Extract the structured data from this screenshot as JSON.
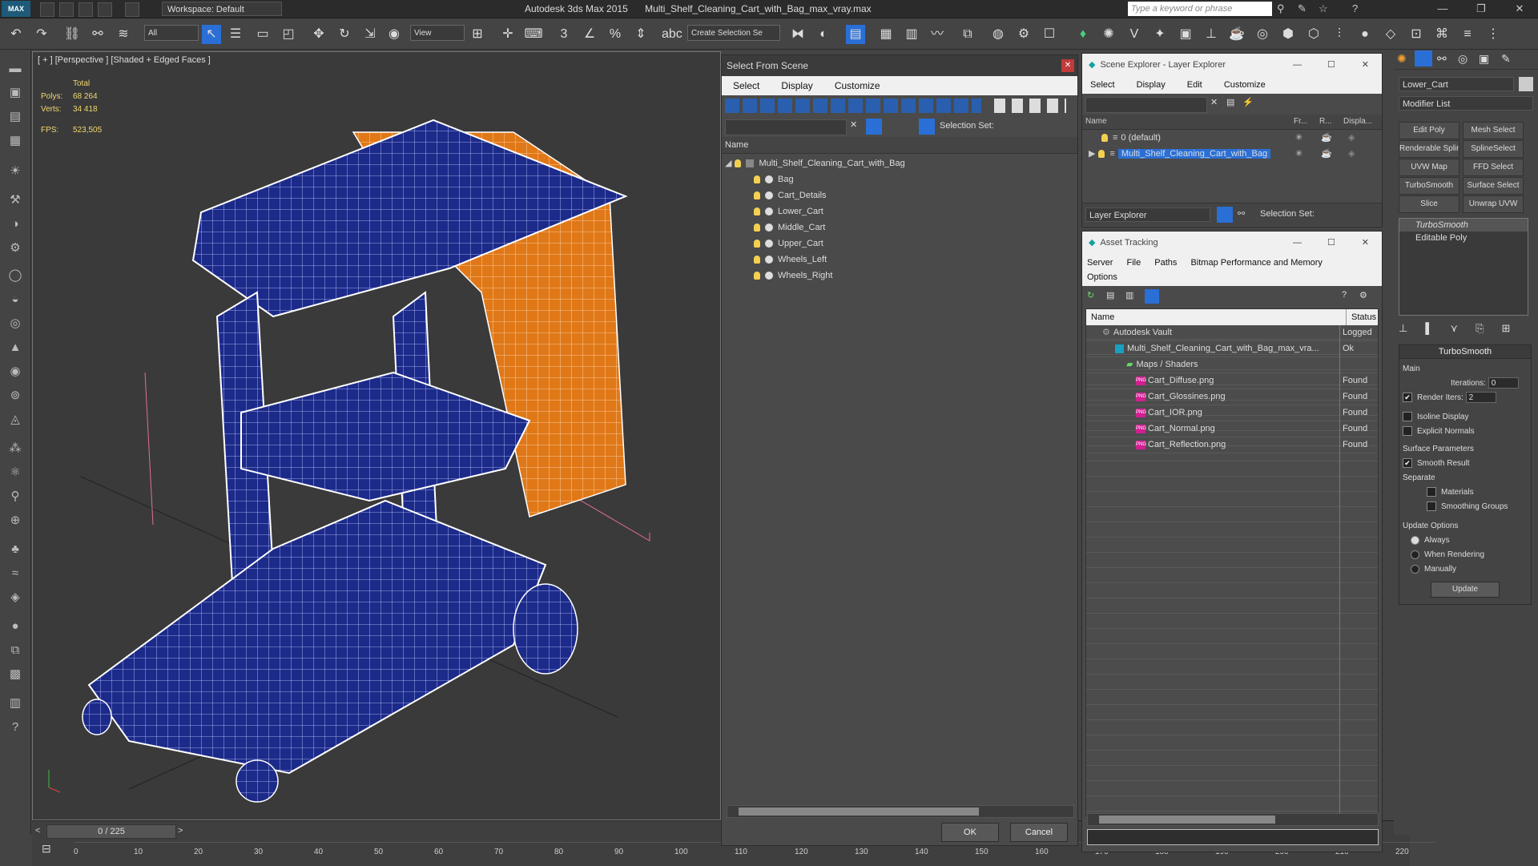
{
  "titlebar": {
    "logo": "MAX",
    "workspace": "Workspace: Default",
    "app_name": "Autodesk 3ds Max  2015",
    "file_name": "Multi_Shelf_Cleaning_Cart_with_Bag_max_vray.max",
    "search_placeholder": "Type a keyword or phrase"
  },
  "toolbar": {
    "selection_filter": "All",
    "ref_coord": "View",
    "create_selection_set": "Create Selection Se"
  },
  "viewport": {
    "label": "[ + ] [Perspective ] [Shaded + Edged Faces ]",
    "stats": {
      "total_label": "Total",
      "polys_label": "Polys:",
      "polys_value": "68 264",
      "verts_label": "Verts:",
      "verts_value": "34 418",
      "fps_label": "FPS:",
      "fps_value": "523,505"
    }
  },
  "timeline": {
    "frame_counter": "0 / 225",
    "ticks": [
      "0",
      "10",
      "20",
      "30",
      "40",
      "50",
      "60",
      "70",
      "80",
      "90",
      "100",
      "110",
      "120",
      "130",
      "140",
      "150",
      "160",
      "170",
      "180",
      "190",
      "200",
      "210",
      "220"
    ]
  },
  "select_from_scene": {
    "title": "Select From Scene",
    "menu": [
      "Select",
      "Display",
      "Customize"
    ],
    "selection_set_label": "Selection Set:",
    "column_name": "Name",
    "root": "Multi_Shelf_Cleaning_Cart_with_Bag",
    "children": [
      "Bag",
      "Cart_Details",
      "Lower_Cart",
      "Middle_Cart",
      "Upper_Cart",
      "Wheels_Left",
      "Wheels_Right"
    ],
    "ok": "OK",
    "cancel": "Cancel"
  },
  "scene_explorer": {
    "title": "Scene Explorer - Layer Explorer",
    "menu": [
      "Select",
      "Display",
      "Edit",
      "Customize"
    ],
    "columns": [
      "Name",
      "Fr...",
      "R...",
      "Displa..."
    ],
    "rows": [
      "0 (default)",
      "Multi_Shelf_Cleaning_Cart_with_Bag"
    ],
    "footer_dropdown": "Layer Explorer",
    "selection_set_label": "Selection Set:"
  },
  "asset_tracking": {
    "title": "Asset Tracking",
    "menu": [
      "Server",
      "File",
      "Paths",
      "Bitmap Performance and Memory",
      "Options"
    ],
    "columns": [
      "Name",
      "Status"
    ],
    "rows": [
      {
        "name": "Autodesk Vault",
        "status": "Logged"
      },
      {
        "name": "Multi_Shelf_Cleaning_Cart_with_Bag_max_vra...",
        "status": "Ok"
      },
      {
        "name": "Maps / Shaders",
        "status": ""
      },
      {
        "name": "Cart_Diffuse.png",
        "status": "Found"
      },
      {
        "name": "Cart_Glossines.png",
        "status": "Found"
      },
      {
        "name": "Cart_IOR.png",
        "status": "Found"
      },
      {
        "name": "Cart_Normal.png",
        "status": "Found"
      },
      {
        "name": "Cart_Reflection.png",
        "status": "Found"
      }
    ]
  },
  "command_panel": {
    "object_name": "Lower_Cart",
    "modifier_list": "Modifier List",
    "buttons": [
      "Edit Poly",
      "Mesh Select",
      "Renderable Spline",
      "SplineSelect",
      "UVW Map",
      "FFD Select",
      "TurboSmooth",
      "Surface Select",
      "Slice",
      "Unwrap UVW"
    ],
    "stack": [
      "TurboSmooth",
      "Editable Poly"
    ],
    "turbosmooth": {
      "title": "TurboSmooth",
      "main": "Main",
      "iterations_label": "Iterations:",
      "iterations_value": "0",
      "render_iters_label": "Render Iters:",
      "render_iters_value": "2",
      "isoline_display": "Isoline Display",
      "explicit_normals": "Explicit Normals",
      "surface_parameters": "Surface Parameters",
      "smooth_result": "Smooth Result",
      "separate": "Separate",
      "materials": "Materials",
      "smoothing_groups": "Smoothing Groups",
      "update_options": "Update Options",
      "always": "Always",
      "when_rendering": "When Rendering",
      "manually": "Manually",
      "update_button": "Update"
    }
  },
  "colors": {
    "mesh_blue": "#1c2a8a",
    "bag_orange": "#e07818",
    "wire": "#ffffff",
    "accent": "#2a6fd6"
  }
}
